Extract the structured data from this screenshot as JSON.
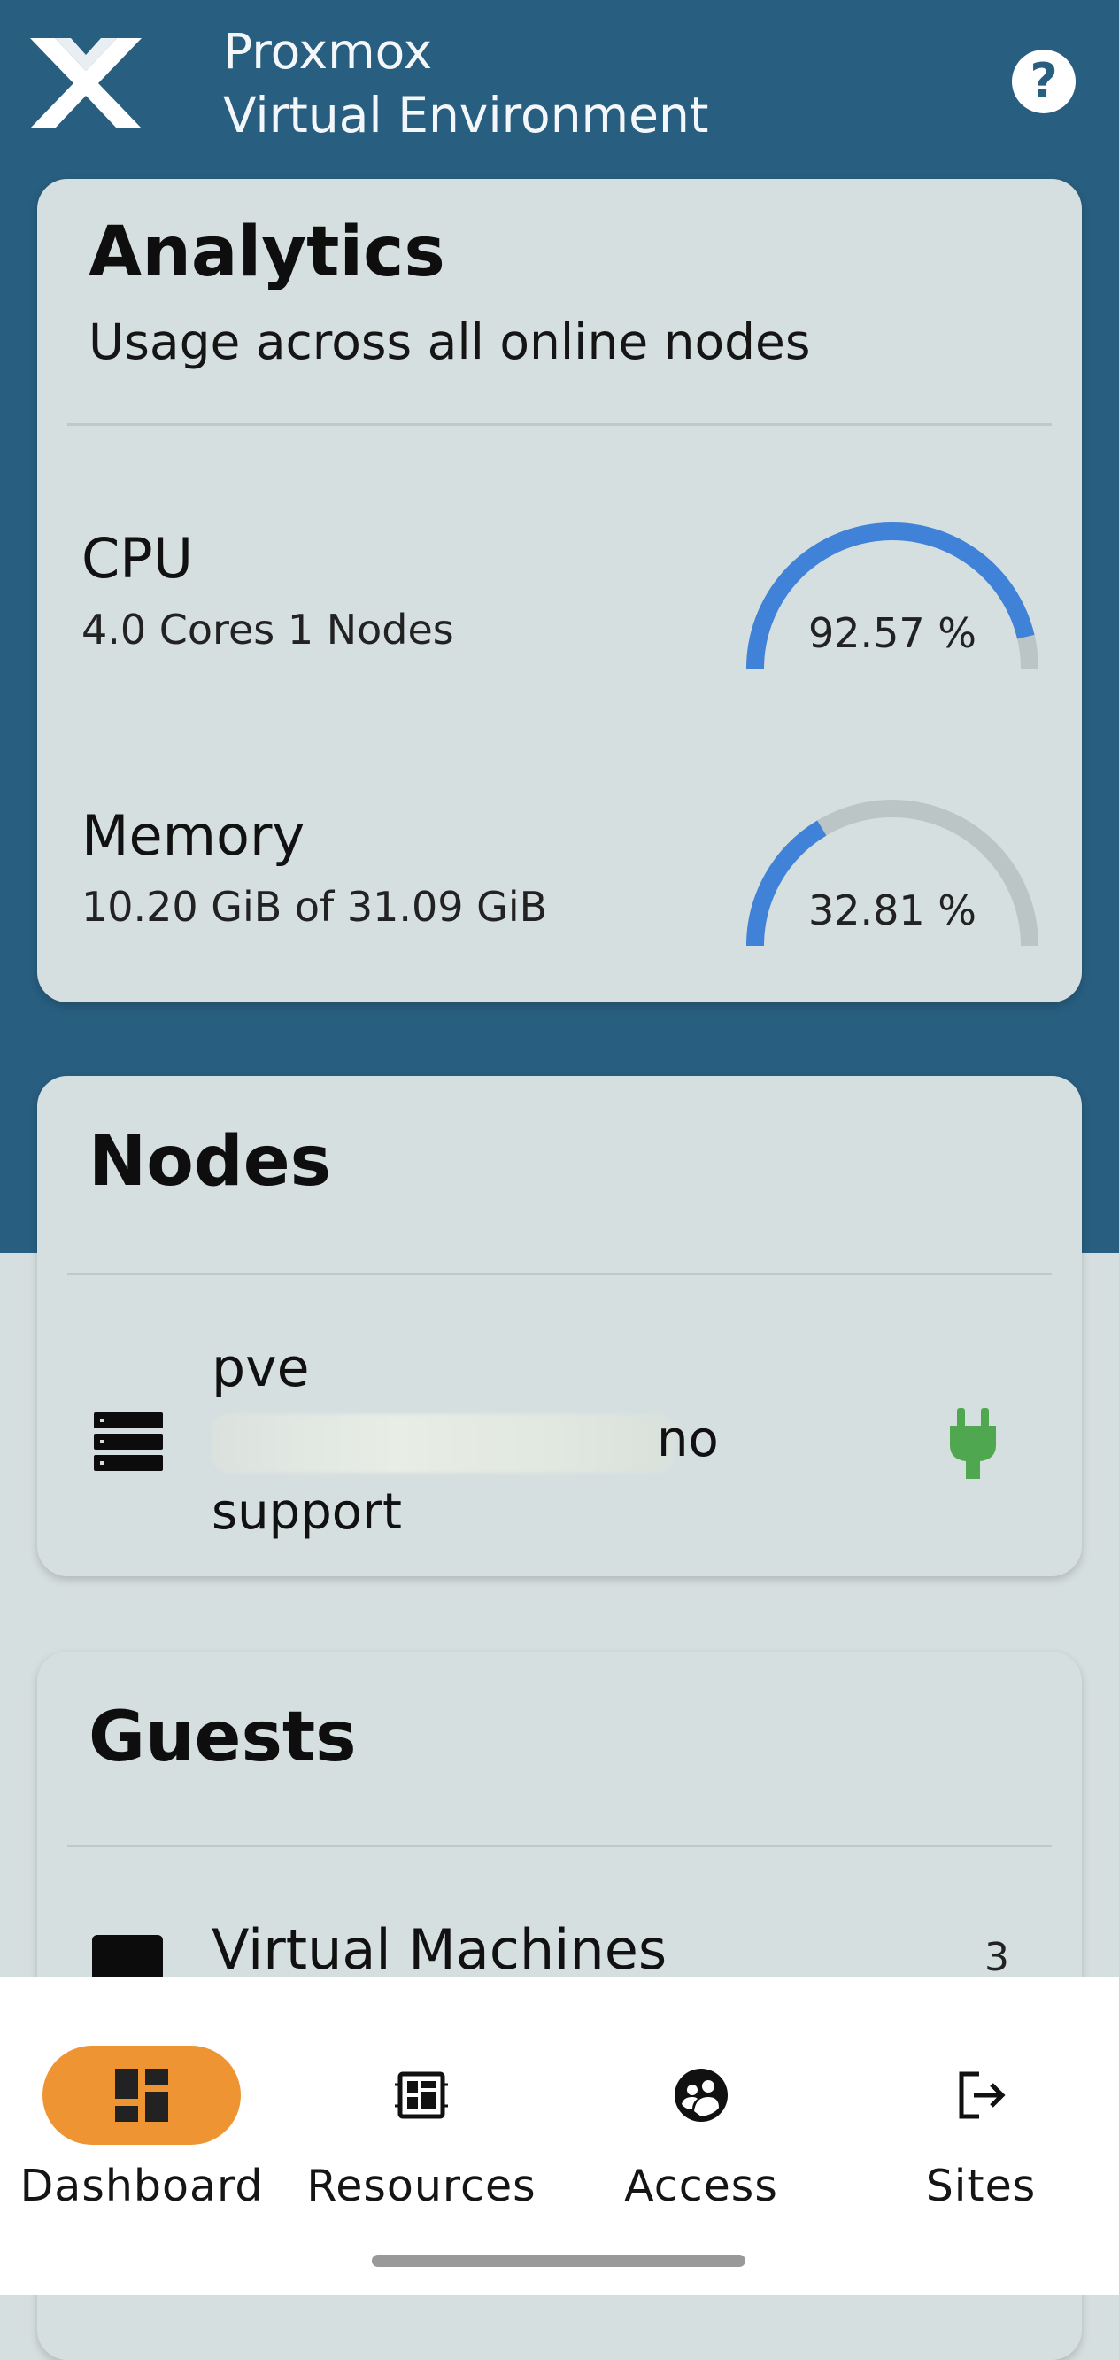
{
  "app": {
    "title_line1": "Proxmox",
    "title_line2": "Virtual Environment",
    "help_glyph": "?"
  },
  "colors": {
    "header": "#285e7f",
    "background": "#d6dfe0",
    "gauge_fill": "#3f82d8",
    "gauge_track": "#bcc5c5",
    "nav_active": "#ee9433",
    "online": "#4fa84f"
  },
  "analytics": {
    "title": "Analytics",
    "subtitle": "Usage across all online nodes",
    "cpu": {
      "label": "CPU",
      "detail": "4.0 Cores 1 Nodes",
      "value_text": "92.57 %",
      "percent": 92.57
    },
    "memory": {
      "label": "Memory",
      "detail": "10.20 GiB of 31.09 GiB",
      "value_text": "32.81 %",
      "percent": 32.81
    }
  },
  "nodes": {
    "title": "Nodes",
    "items": [
      {
        "name": "pve",
        "support_no": "no",
        "support": "support",
        "icon": "server-icon",
        "status_icon": "plug-icon"
      }
    ]
  },
  "guests": {
    "title": "Guests",
    "items": [
      {
        "label": "Virtual Machines",
        "count": "3",
        "icon": "monitor-icon"
      }
    ]
  },
  "nav": {
    "items": [
      {
        "label": "Dashboard",
        "icon": "dashboard-icon",
        "active": true
      },
      {
        "label": "Resources",
        "icon": "resources-icon",
        "active": false
      },
      {
        "label": "Access",
        "icon": "access-icon",
        "active": false
      },
      {
        "label": "Sites",
        "icon": "sites-icon",
        "active": false
      }
    ]
  }
}
